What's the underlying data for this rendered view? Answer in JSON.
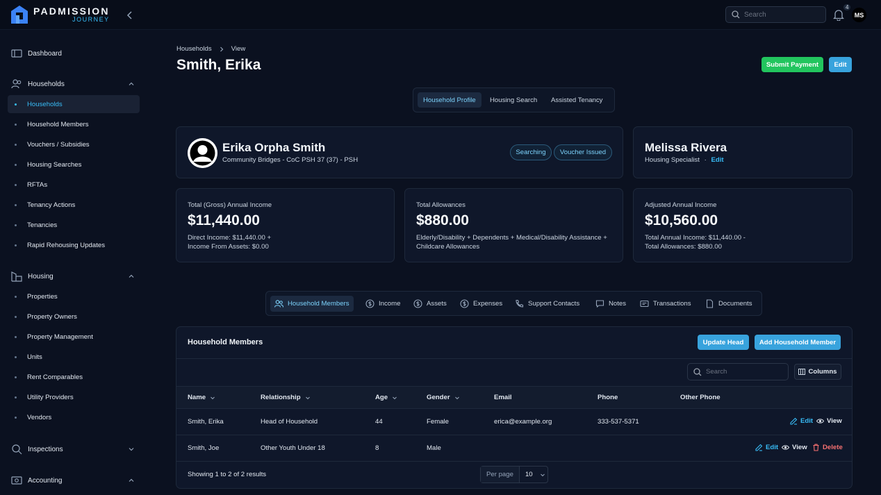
{
  "app": {
    "logo_line1": "PADMISSION",
    "logo_line2": "JOURNEY",
    "search_placeholder": "Search",
    "notification_count": "4",
    "user_initials": "MS"
  },
  "sidebar": {
    "dashboard": "Dashboard",
    "households_group": "Households",
    "households_items": [
      "Households",
      "Household Members",
      "Vouchers / Subsidies",
      "Housing Searches",
      "RFTAs",
      "Tenancy Actions",
      "Tenancies",
      "Rapid Rehousing Updates"
    ],
    "housing_group": "Housing",
    "housing_items": [
      "Properties",
      "Property Owners",
      "Property Management",
      "Units",
      "Rent Comparables",
      "Utility Providers",
      "Vendors"
    ],
    "inspections": "Inspections",
    "accounting": "Accounting"
  },
  "breadcrumb": {
    "parent": "Households",
    "current": "View"
  },
  "page": {
    "title": "Smith, Erika",
    "submit_payment": "Submit Payment",
    "edit": "Edit"
  },
  "tabs": [
    "Household Profile",
    "Housing Search",
    "Assisted Tenancy"
  ],
  "profile": {
    "name": "Erika Orpha Smith",
    "subtitle": "Community Bridges - CoC PSH 37 (37) - PSH",
    "badges": [
      "Searching",
      "Voucher Issued"
    ]
  },
  "specialist": {
    "name": "Melissa Rivera",
    "role": "Housing Specialist",
    "separator": "·",
    "edit": "Edit"
  },
  "stats": [
    {
      "label": "Total (Gross) Annual Income",
      "value": "$11,440.00",
      "desc": "Direct Income: $11,440.00 + Income From Assets: $0.00"
    },
    {
      "label": "Total Allowances",
      "value": "$880.00",
      "desc": "Elderly/Disability + Dependents + Medical/Disability Assistance + Childcare Allowances"
    },
    {
      "label": "Adjusted Annual Income",
      "value": "$10,560.00",
      "desc": "Total Annual Income: $11,440.00 - Total Allowances: $880.00"
    }
  ],
  "subtabs": [
    "Household Members",
    "Income",
    "Assets",
    "Expenses",
    "Support Contacts",
    "Notes",
    "Transactions",
    "Documents"
  ],
  "members": {
    "title": "Household Members",
    "update_head": "Update Head",
    "add_member": "Add Household Member",
    "search_placeholder": "Search",
    "columns_btn": "Columns",
    "headers": [
      "Name",
      "Relationship",
      "Age",
      "Gender",
      "Email",
      "Phone",
      "Other Phone"
    ],
    "rows": [
      {
        "name": "Smith, Erika",
        "relationship": "Head of Household",
        "age": "44",
        "gender": "Female",
        "email": "erica@example.org",
        "phone": "333-537-5371",
        "other_phone": ""
      },
      {
        "name": "Smith, Joe",
        "relationship": "Other Youth Under 18",
        "age": "8",
        "gender": "Male",
        "email": "",
        "phone": "",
        "other_phone": ""
      }
    ],
    "action_edit": "Edit",
    "action_view": "View",
    "action_delete": "Delete",
    "showing": "Showing 1 to 2 of 2 results",
    "per_page_label": "Per page",
    "per_page_value": "10"
  }
}
